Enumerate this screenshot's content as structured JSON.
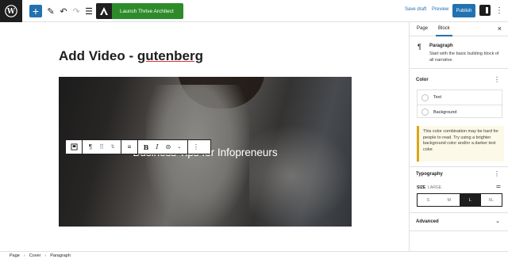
{
  "header": {
    "thrive_label": "Launch Thrive Architect",
    "save_draft": "Save draft",
    "preview": "Preview",
    "publish": "Publish"
  },
  "editor": {
    "title_prefix": "Add Video - ",
    "title_underlined": "gutenberg",
    "cover_text": "Business Tips for Infopreneurs"
  },
  "sidebar": {
    "tabs": [
      "Page",
      "Block"
    ],
    "active_tab": "Block",
    "block_name": "Paragraph",
    "block_desc": "Start with the basic building block of all narrative.",
    "color_heading": "Color",
    "color_items": [
      "Text",
      "Background"
    ],
    "notice": "This color combination may be hard for people to read. Try using a brighter background color and/or a darker text color.",
    "typography_heading": "Typography",
    "size_label": "SIZE",
    "size_value": "LARGE",
    "sizes": [
      "S",
      "M",
      "L",
      "XL"
    ],
    "active_size": "L",
    "advanced_heading": "Advanced"
  },
  "breadcrumb": [
    "Page",
    "Cover",
    "Paragraph"
  ],
  "colors": {
    "accent": "#2271b1",
    "thrive_green": "#2d8b2a",
    "notice_border": "#dba617"
  }
}
